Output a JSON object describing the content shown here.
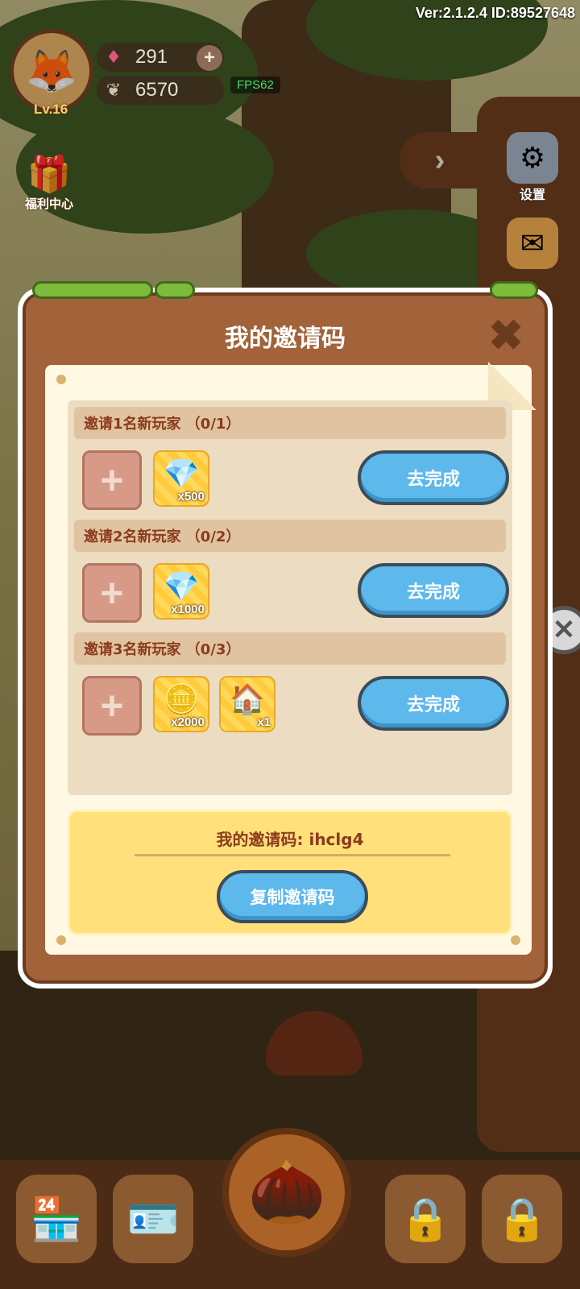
{
  "hud": {
    "version": "Ver:2.1.2.4 ID:89527648",
    "level": "Lv.16",
    "gems": "291",
    "seeds": "6570",
    "fps": "FPS62",
    "welfare_label": "福利中心"
  },
  "side_menu": {
    "settings_label": "设置",
    "mail_label": "邮件"
  },
  "dialog": {
    "title": "我的邀请码",
    "tasks": [
      {
        "header": "邀请1名新玩家 （0/1）",
        "rewards": [
          {
            "icon": "diamond-pile-icon",
            "qty": "x500"
          }
        ],
        "button": "去完成"
      },
      {
        "header": "邀请2名新玩家 （0/2）",
        "rewards": [
          {
            "icon": "diamond-pile-icon",
            "qty": "x1000"
          }
        ],
        "button": "去完成"
      },
      {
        "header": "邀请3名新玩家 （0/3）",
        "rewards": [
          {
            "icon": "coin-stack-icon",
            "qty": "x2000"
          },
          {
            "icon": "house-icon",
            "qty": "x1"
          }
        ],
        "button": "去完成"
      }
    ],
    "invite_code_text": "我的邀请码: ihclg4",
    "copy_button": "复制邀请码"
  },
  "colors": {
    "dialog_wood": "#a2623a",
    "button_blue": "#5db8ec",
    "code_box_yellow": "#ffe07a",
    "task_header_text": "#8b3b1c"
  }
}
